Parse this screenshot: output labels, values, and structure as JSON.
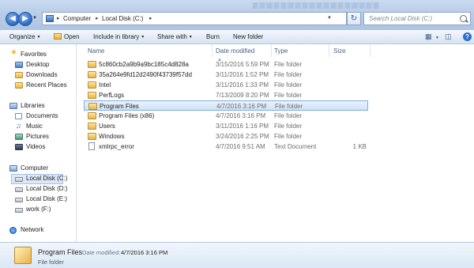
{
  "address": {
    "crumbs": [
      "Computer",
      "Local Disk (C:)"
    ],
    "search_placeholder": "Search Local Disk (C:)"
  },
  "toolbar": {
    "organize": "Organize",
    "open": "Open",
    "include_in_library": "Include in library",
    "share_with": "Share with",
    "burn": "Burn",
    "new_folder": "New folder"
  },
  "sidebar": {
    "favorites_header": "Favorites",
    "favorites": [
      "Desktop",
      "Downloads",
      "Recent Places"
    ],
    "libraries_header": "Libraries",
    "libraries": [
      "Documents",
      "Music",
      "Pictures",
      "Videos"
    ],
    "computer_header": "Computer",
    "drives": [
      "Local Disk (C:)",
      "Local Disk (D:)",
      "Local Disk (E:)",
      "work (F:)"
    ],
    "network_header": "Network",
    "selected_drive": "Local Disk (C:)"
  },
  "columns": {
    "name": "Name",
    "date_modified": "Date modified",
    "type": "Type",
    "size": "Size"
  },
  "files": [
    {
      "name": "5c860cb2a9b9a9bc185c4d828a",
      "date": "3/15/2016 5:59 PM",
      "type": "File folder",
      "size": "",
      "kind": "folder"
    },
    {
      "name": "35a264e9fd12d2490f43739f57dd",
      "date": "3/11/2016 1:52 PM",
      "type": "File folder",
      "size": "",
      "kind": "folder"
    },
    {
      "name": "Intel",
      "date": "3/11/2016 1:33 PM",
      "type": "File folder",
      "size": "",
      "kind": "folder"
    },
    {
      "name": "PerfLogs",
      "date": "7/13/2009 8:20 PM",
      "type": "File folder",
      "size": "",
      "kind": "folder"
    },
    {
      "name": "Program Files",
      "date": "4/7/2016 3:16 PM",
      "type": "File folder",
      "size": "",
      "kind": "folder",
      "selected": true
    },
    {
      "name": "Program Files (x86)",
      "date": "4/7/2016 3:16 PM",
      "type": "File folder",
      "size": "",
      "kind": "folder"
    },
    {
      "name": "Users",
      "date": "3/11/2016 1:16 PM",
      "type": "File folder",
      "size": "",
      "kind": "folder"
    },
    {
      "name": "Windows",
      "date": "3/24/2016 2:25 PM",
      "type": "File folder",
      "size": "",
      "kind": "folder"
    },
    {
      "name": "xmlrpc_error",
      "date": "4/7/2016 9:51 AM",
      "type": "Text Document",
      "size": "1 KB",
      "kind": "text"
    }
  ],
  "details": {
    "name": "Program Files",
    "date_label": "Date modified:",
    "date_value": "4/7/2016 3:16 PM",
    "type": "File folder"
  }
}
